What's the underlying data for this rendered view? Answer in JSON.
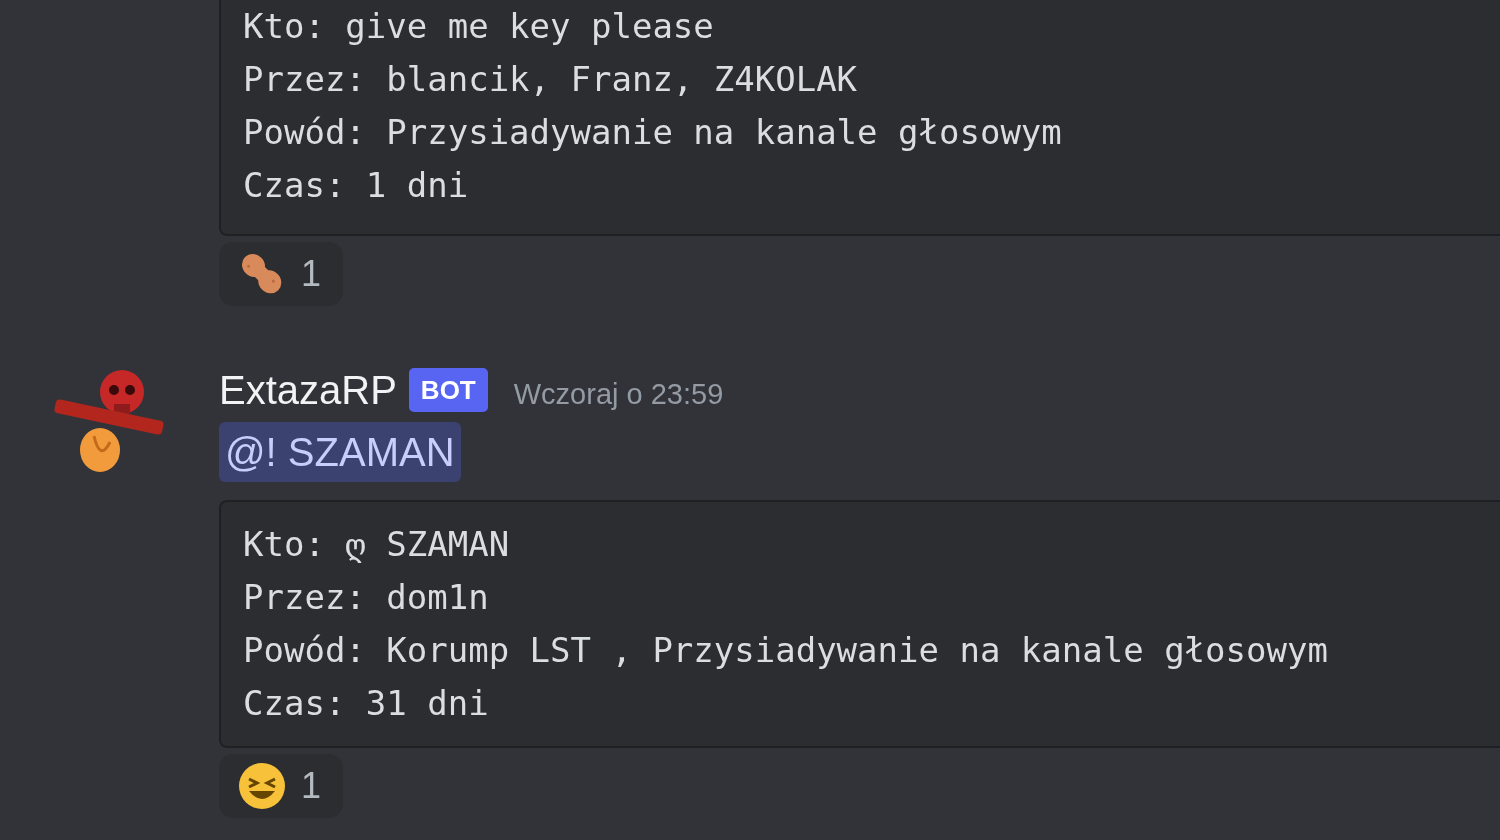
{
  "messages": [
    {
      "kind": "continuation",
      "embed_lines": [
        "Kto: give me key please",
        "Przez: blancik, Franz, Z4KOLAK",
        "Powód: Przysiadywanie na kanale głosowym",
        "Czas: 1 dni"
      ],
      "reactions": [
        {
          "kind": "peanut",
          "count": "1"
        }
      ]
    },
    {
      "kind": "header",
      "author": "ExtazaRP",
      "badge": "BOT",
      "timestamp": "Wczoraj o 23:59",
      "mention": "@! SZAMAN",
      "embed_lines": [
        "Kto: ღ SZAMAN",
        "Przez: dom1n",
        "Powód: Korump LST , Przysiadywanie na kanale głosowym",
        "Czas: 31 dni"
      ],
      "reactions": [
        {
          "kind": "grin",
          "count": "1"
        }
      ]
    }
  ]
}
